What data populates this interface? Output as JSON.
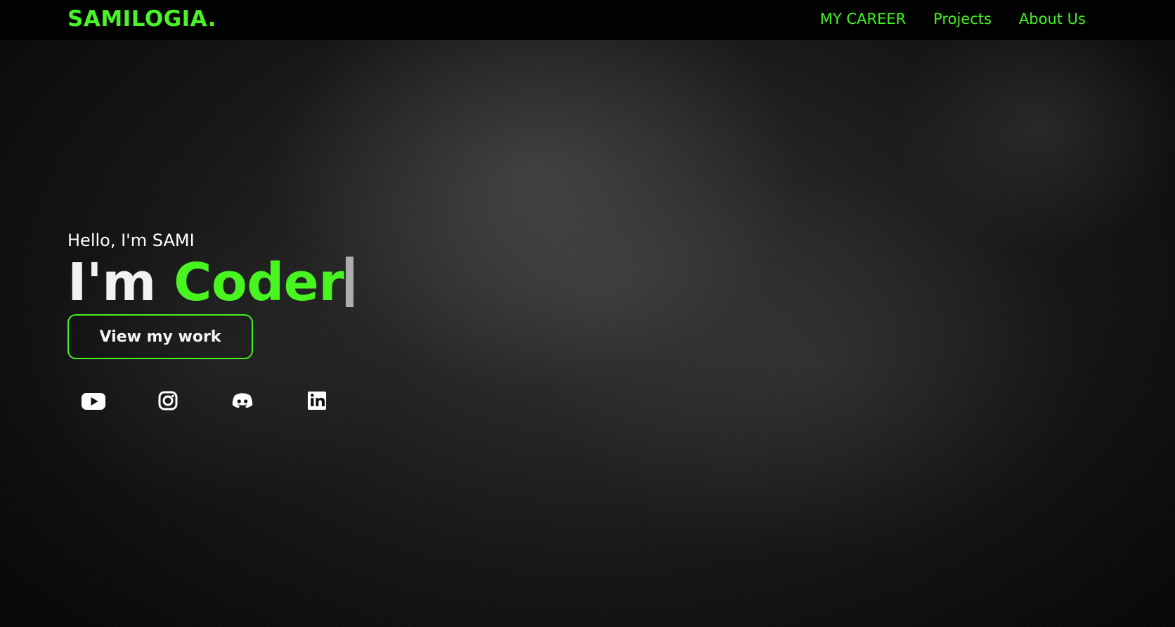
{
  "brand": {
    "logo_text": "SAMILOGIA."
  },
  "navigation": {
    "items": [
      {
        "label": "MY CAREER"
      },
      {
        "label": "Projects"
      },
      {
        "label": "About Us"
      }
    ]
  },
  "hero": {
    "greeting": "Hello, I'm SAMI",
    "headline_prefix": "I'm",
    "headline_role": "Coder",
    "cta_label": "View my work"
  },
  "social": {
    "icons": [
      {
        "name": "youtube-icon"
      },
      {
        "name": "instagram-icon"
      },
      {
        "name": "discord-icon"
      },
      {
        "name": "linkedin-icon"
      }
    ]
  },
  "theme": {
    "accent": "#49f526",
    "text": "#ffffff",
    "background": "#0b0b0b"
  }
}
